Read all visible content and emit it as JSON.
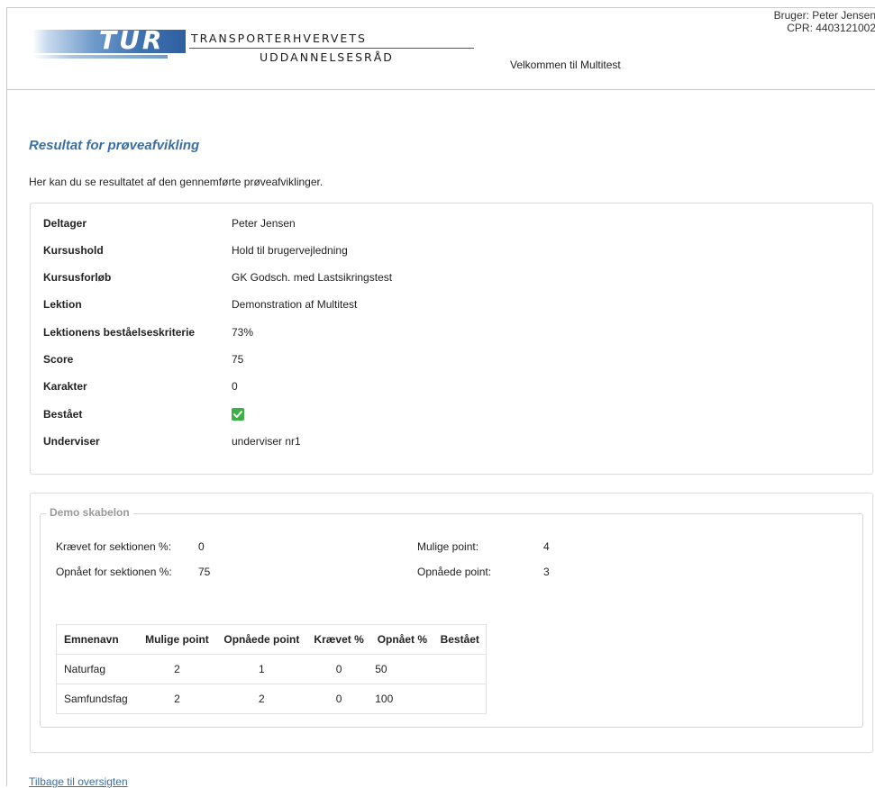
{
  "header": {
    "logo_text": "TUR",
    "org_line1": "TRANSPORTERHVERVETS",
    "org_line2": "UDDANNELSESRÅD",
    "welcome": "Velkommen til Multitest",
    "user": "Bruger: Peter Jensen",
    "cpr": "CPR: 4403121002"
  },
  "page": {
    "title": "Resultat for prøveafvikling",
    "intro": "Her kan du se resultatet af den gennemførte prøveafviklinger."
  },
  "details": [
    {
      "label": "Deltager",
      "value": "Peter Jensen"
    },
    {
      "label": "Kursushold",
      "value": "Hold til brugervejledning"
    },
    {
      "label": "Kursusforløb",
      "value": "GK Godsch. med Lastsikringstest"
    },
    {
      "label": "Lektion",
      "value": "Demonstration af Multitest"
    },
    {
      "label": "Lektionens beståelseskriterie",
      "value": "73%"
    },
    {
      "label": "Score",
      "value": "75"
    },
    {
      "label": "Karakter",
      "value": "0"
    },
    {
      "label": "Bestået",
      "value": "",
      "passed": true
    },
    {
      "label": "Underviser",
      "value": "underviser nr1"
    }
  ],
  "section": {
    "legend": "Demo skabelon",
    "required_label": "Krævet for sektionen %:",
    "required_value": "0",
    "achieved_label": "Opnået for sektionen %:",
    "achieved_value": "75",
    "possible_label": "Mulige point:",
    "possible_value": "4",
    "earned_label": "Opnåede point:",
    "earned_value": "3"
  },
  "topics_table": {
    "headers": [
      "Emnenavn",
      "Mulige point",
      "Opnåede point",
      "Krævet %",
      "Opnået %",
      "Bestået"
    ],
    "rows": [
      [
        "Naturfag",
        "2",
        "1",
        "0",
        "50",
        ""
      ],
      [
        "Samfundsfag",
        "2",
        "2",
        "0",
        "100",
        ""
      ]
    ]
  },
  "footer": {
    "back_link": "Tilbage til oversigten"
  },
  "colors": {
    "title_blue": "#3a6fa5",
    "check_green": "#3cb043"
  }
}
